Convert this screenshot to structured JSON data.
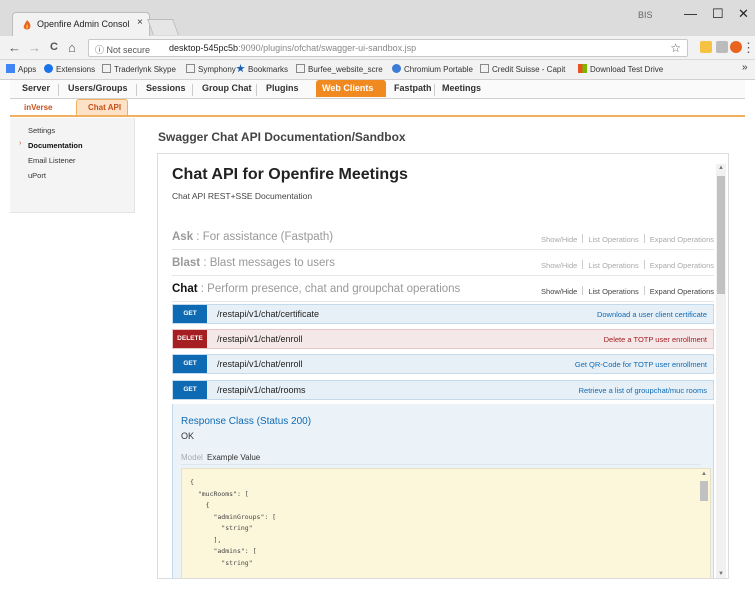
{
  "browser": {
    "tab_title": "Openfire Admin Console",
    "tab_close": "×",
    "window_user": "BIS",
    "window_controls": {
      "minimize": "—",
      "maximize": "☐",
      "close": "✕"
    },
    "nav": {
      "back": "←",
      "forward": "→",
      "reload": "C",
      "home": "⌂"
    },
    "security_label": "ⓘ Not secure",
    "url_host": "desktop-545pc5b",
    "url_path": ":9090/plugins/ofchat/swagger-ui-sandbox.jsp",
    "star": "☆",
    "menu": "⋮",
    "bookmarks": [
      {
        "label": "Apps",
        "color": "#4285f4"
      },
      {
        "label": "Extensions",
        "color": "#1a73e8"
      },
      {
        "label": "Traderlynk Skype",
        "color": "#777777"
      },
      {
        "label": "Symphony",
        "color": "#777777"
      },
      {
        "label": "Bookmarks",
        "color": "#1a5fb4"
      },
      {
        "label": "Burfee_website_scre",
        "color": "#777777"
      },
      {
        "label": "Chromium Portable",
        "color": "#3c7bd6"
      },
      {
        "label": "Credit Suisse - Capit",
        "color": "#777777"
      },
      {
        "label": "Download Test Drive",
        "color": "#e8a020"
      }
    ],
    "bookmarks_more": "»"
  },
  "admin_nav": {
    "items": [
      "Server",
      "Users/Groups",
      "Sessions",
      "Group Chat",
      "Plugins",
      "Web Clients",
      "Fastpath",
      "Meetings"
    ],
    "active": "Web Clients",
    "sub_items": [
      "inVerse",
      "Chat API"
    ],
    "sub_active": "Chat API"
  },
  "sidebar": {
    "items": [
      "Settings",
      "Documentation",
      "Email Listener",
      "uPort"
    ],
    "active": "Documentation",
    "active_marker": "›"
  },
  "page_title": "Swagger Chat API Documentation/Sandbox",
  "api": {
    "title": "Chat API for Openfire Meetings",
    "description": "Chat API REST+SSE Documentation",
    "op_links": [
      "Show/Hide",
      "List Operations",
      "Expand Operations"
    ],
    "resources": [
      {
        "name": "Ask",
        "desc": " : For assistance (Fastpath)"
      },
      {
        "name": "Blast",
        "desc": " : Blast messages to users"
      },
      {
        "name": "Chat",
        "desc": " : Perform presence, chat and groupchat operations"
      }
    ],
    "operations": [
      {
        "verb": "GET",
        "path": "/restapi/v1/chat/certificate",
        "summary": "Download a user client certificate"
      },
      {
        "verb": "DELETE",
        "path": "/restapi/v1/chat/enroll",
        "summary": "Delete a TOTP user enrollment"
      },
      {
        "verb": "GET",
        "path": "/restapi/v1/chat/enroll",
        "summary": "Get QR-Code for TOTP user enrollment"
      },
      {
        "verb": "GET",
        "path": "/restapi/v1/chat/rooms",
        "summary": "Retrieve a list of groupchat/muc rooms"
      }
    ],
    "response_class": "Response Class (Status 200)",
    "response_ok": "OK",
    "model_tab": "Model",
    "example_tab": "Example Value",
    "example_code": "{\n  \"mucRooms\": [\n    {\n      \"adminGroups\": [\n        \"string\"\n      ],\n      \"admins\": [\n        \"string\""
  },
  "colors": {
    "accent": "#f08a20",
    "get": "#0f6ab4",
    "delete": "#a41e22"
  }
}
